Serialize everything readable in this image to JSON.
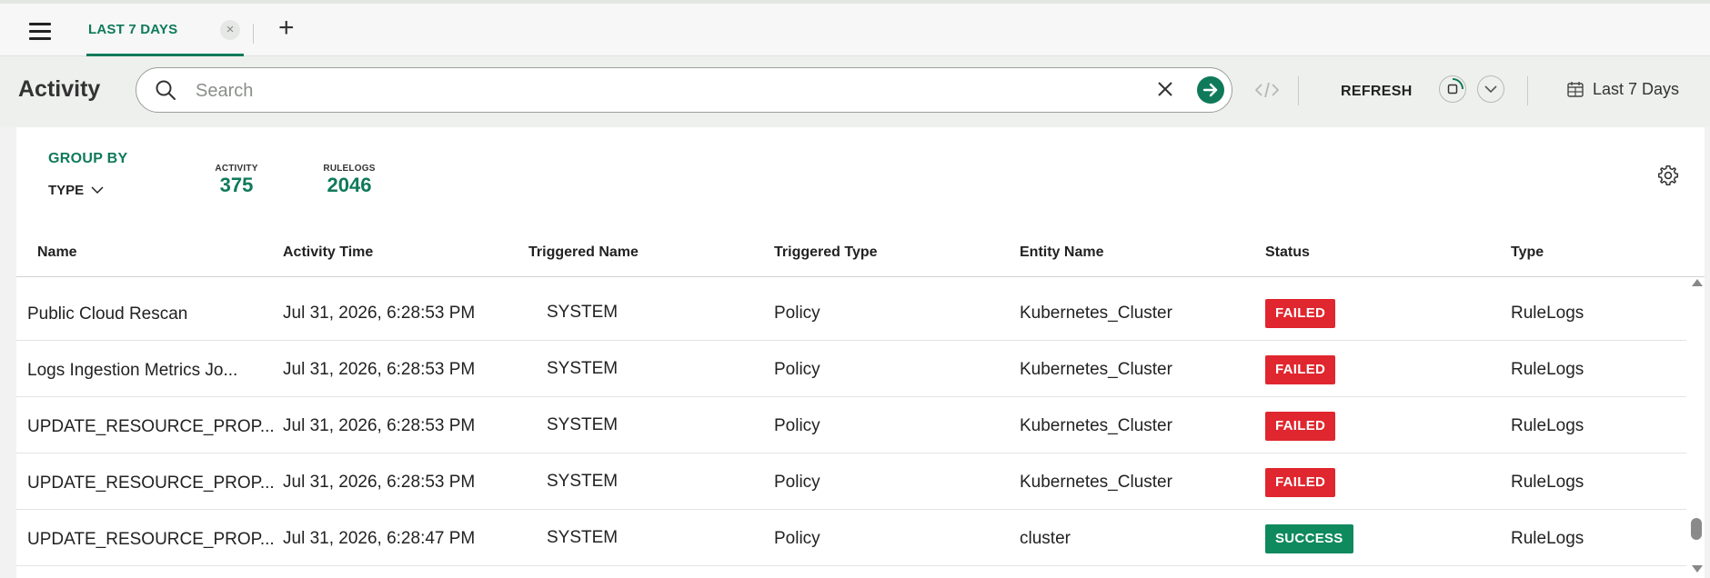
{
  "tabs": {
    "active_label": "LAST 7 DAYS",
    "close_symbol": "×",
    "add_symbol": "+"
  },
  "header": {
    "title": "Activity"
  },
  "search": {
    "placeholder": "Search",
    "value": ""
  },
  "toolbar": {
    "refresh_label": "REFRESH",
    "date_range_label": "Last 7 Days"
  },
  "summary": {
    "group_by_label": "GROUP BY",
    "group_by_value": "TYPE",
    "stats": [
      {
        "label": "ACTIVITY",
        "value": "375"
      },
      {
        "label": "RULELOGS",
        "value": "2046"
      }
    ]
  },
  "table": {
    "columns": [
      "Name",
      "Activity Time",
      "Triggered Name",
      "Triggered Type",
      "Entity Name",
      "Status",
      "Type"
    ],
    "rows": [
      {
        "name": "Public Cloud Rescan",
        "time": "Jul 31, 2026, 6:28:53 PM",
        "triggered_name": "SYSTEM",
        "triggered_type": "Policy",
        "entity": "Kubernetes_Cluster",
        "status": "FAILED",
        "type": "RuleLogs"
      },
      {
        "name": "Logs Ingestion Metrics Jo...",
        "time": "Jul 31, 2026, 6:28:53 PM",
        "triggered_name": "SYSTEM",
        "triggered_type": "Policy",
        "entity": "Kubernetes_Cluster",
        "status": "FAILED",
        "type": "RuleLogs"
      },
      {
        "name": "UPDATE_RESOURCE_PROP...",
        "time": "Jul 31, 2026, 6:28:53 PM",
        "triggered_name": "SYSTEM",
        "triggered_type": "Policy",
        "entity": "Kubernetes_Cluster",
        "status": "FAILED",
        "type": "RuleLogs"
      },
      {
        "name": "UPDATE_RESOURCE_PROP...",
        "time": "Jul 31, 2026, 6:28:53 PM",
        "triggered_name": "SYSTEM",
        "triggered_type": "Policy",
        "entity": "Kubernetes_Cluster",
        "status": "FAILED",
        "type": "RuleLogs"
      },
      {
        "name": "UPDATE_RESOURCE_PROP...",
        "time": "Jul 31, 2026, 6:28:47 PM",
        "triggered_name": "SYSTEM",
        "triggered_type": "Policy",
        "entity": "cluster",
        "status": "SUCCESS",
        "type": "RuleLogs"
      }
    ]
  },
  "colors": {
    "accent": "#0f7a5a",
    "failed": "#e0262e",
    "success": "#0f8a5f"
  },
  "icons": [
    "hamburger-menu-icon",
    "close-icon",
    "plus-icon",
    "search-icon",
    "clear-icon",
    "arrow-right-icon",
    "code-icon",
    "auto-refresh-icon",
    "chevron-down-icon",
    "calendar-icon",
    "gear-icon"
  ]
}
